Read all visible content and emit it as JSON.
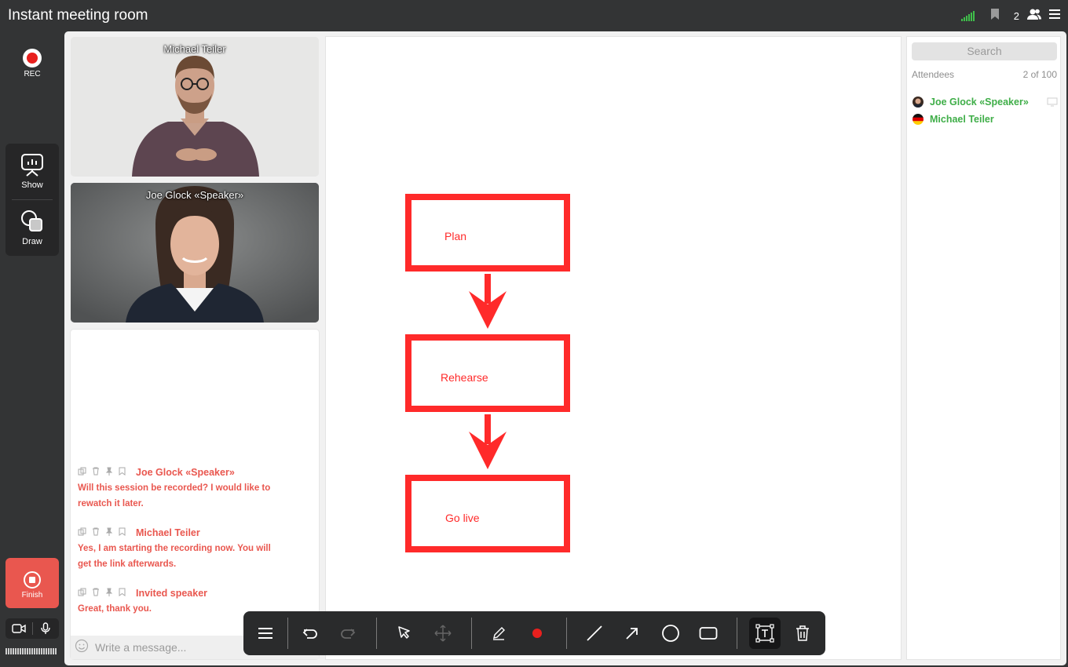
{
  "app": {
    "title": "Instant meeting room",
    "attendee_count": "2"
  },
  "left_rail": {
    "rec_label": "REC",
    "show_label": "Show",
    "draw_label": "Draw",
    "finish_label": "Finish"
  },
  "videos": [
    {
      "name": "Michael Teiler"
    },
    {
      "name": "Joe Glock «Speaker»"
    }
  ],
  "chat": {
    "messages": [
      {
        "author": "Joe Glock «Speaker»",
        "text_lines": [
          "Will this session be recorded? I would like to",
          "rewatch it later."
        ]
      },
      {
        "author": "Michael Teiler",
        "text_lines": [
          "Yes, I am starting the recording now. You will",
          "get the link afterwards."
        ]
      },
      {
        "author": "Invited speaker",
        "text_lines": [
          "Great, thank you."
        ]
      }
    ],
    "input_placeholder": "Write a message..."
  },
  "whiteboard": {
    "boxes": [
      {
        "label": "Plan"
      },
      {
        "label": "Rehearse"
      },
      {
        "label": "Go live"
      }
    ],
    "color": "#ff2a2a"
  },
  "draw_toolbar": {
    "tools": [
      "menu-icon",
      "undo-icon",
      "redo-icon",
      "select-icon",
      "move-icon",
      "pencil-icon",
      "color-dot",
      "line-icon",
      "arrow-icon",
      "circle-icon",
      "rectangle-icon",
      "text-icon",
      "trash-icon"
    ],
    "active_tool": "text-icon",
    "current_color": "#e8201e"
  },
  "attendees": {
    "search_placeholder": "Search",
    "label": "Attendees",
    "count": "2 of 100",
    "list": [
      {
        "name": "Joe Glock «Speaker»"
      },
      {
        "name": "Michael Teiler"
      }
    ]
  },
  "colors": {
    "accent_red": "#e9574f",
    "attendee_green": "#3fae48",
    "dark_bg": "#333435"
  }
}
